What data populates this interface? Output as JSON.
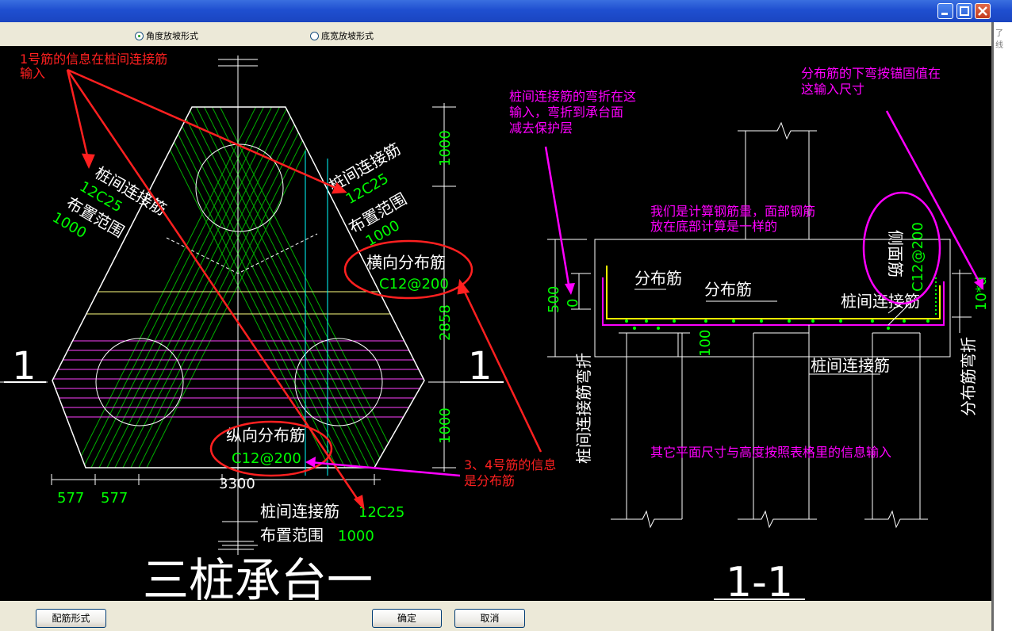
{
  "options": {
    "angle_slope": "角度放坡形式",
    "bottom_width_slope": "底宽放坡形式",
    "selected": "angle_slope"
  },
  "buttons": {
    "rebar_form": "配筋形式",
    "ok": "确定",
    "cancel": "取消"
  },
  "right_panel": {
    "snippet1": "了",
    "snippet2": "线"
  },
  "plan": {
    "title": "三桩承台一",
    "section_mark_left": "1",
    "section_mark_right": "1",
    "left_rebar_label": "桩间连接筋",
    "left_rebar_spec": "12C25",
    "left_range_label": "布置范围",
    "left_range_value": "1000",
    "right_rebar_label": "桩间连接筋",
    "right_rebar_spec": "12C25",
    "right_range_label": "布置范围",
    "right_range_value": "1000",
    "transverse_label": "横向分布筋",
    "transverse_spec": "C12@200",
    "longitudinal_label": "纵向分布筋",
    "longitudinal_spec": "C12@200",
    "bottom_rebar_label": "桩间连接筋",
    "bottom_rebar_spec": "12C25",
    "bottom_range_label": "布置范围",
    "bottom_range_value": "1000",
    "dim_top": "1000",
    "dim_mid": "2858",
    "dim_bottom": "1000",
    "dim_left1": "577",
    "dim_left2": "577",
    "dim_width": "3300"
  },
  "section": {
    "title": "1-1",
    "dim_height": "500",
    "dim_bend": "0",
    "dim_100": "100",
    "dim_10d": "10*d",
    "dist_rebar_1": "分布筋",
    "dist_rebar_2": "分布筋",
    "pile_rebar_1": "桩间连接筋",
    "pile_rebar_2": "桩间连接筋",
    "side_rebar_label": "侧面筋",
    "side_rebar_spec": "C12@200",
    "vertical_label_left": "桩间连接筋弯折",
    "vertical_label_right": "分布筋弯折"
  },
  "annotations": {
    "red_1_line1": "1号筋的信息在桩间连接筋",
    "red_1_line2": "输入",
    "red_2_line1": "3、4号筋的信息",
    "red_2_line2": "是分布筋",
    "magenta_1_line1": "桩间连接筋的弯折在这",
    "magenta_1_line2": "输入，弯折到承台面",
    "magenta_1_line3": "减去保护层",
    "magenta_2_line1": "分布筋的下弯按锚固值在",
    "magenta_2_line2": "这输入尺寸",
    "magenta_3_line1": "我们是计算钢筋量，面部钢筋",
    "magenta_3_line2": "放在底部计算是一样的",
    "magenta_4": "其它平面尺寸与高度按照表格里的信息输入"
  },
  "colors": {
    "red": "#ff2020",
    "magenta": "#ff00ff",
    "green": "#00ff00",
    "white": "#ffffff",
    "yellow": "#ffff00",
    "cyan": "#00ffff"
  }
}
